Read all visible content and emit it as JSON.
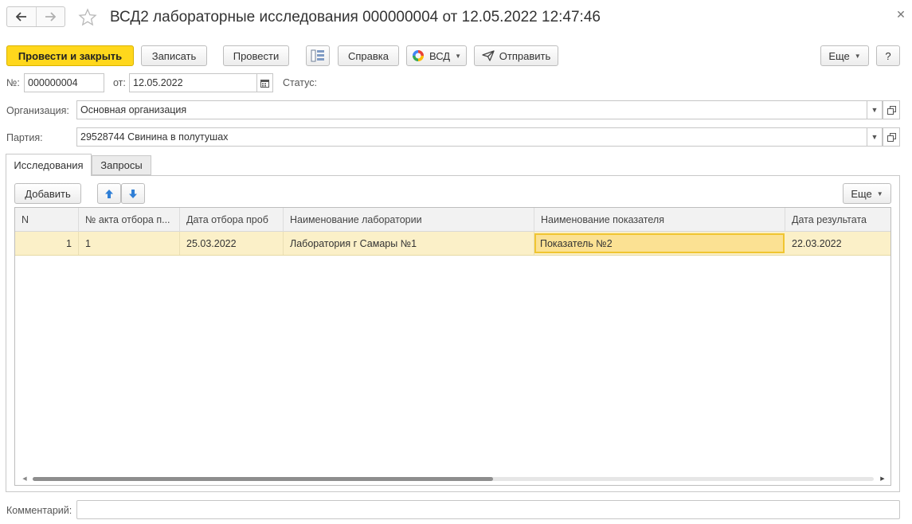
{
  "window": {
    "title": "ВСД2 лабораторные исследования 000000004 от 12.05.2022 12:47:46",
    "back_icon": "arrow-left",
    "forward_icon": "arrow-right",
    "favorite_icon": "star-outline",
    "close_icon": "close-x"
  },
  "toolbar": {
    "post_and_close": "Провести и закрыть",
    "save": "Записать",
    "post": "Провести",
    "structure_icon": "document-structure",
    "help": "Справка",
    "vsd": "ВСД",
    "send": "Отправить",
    "more": "Еще",
    "question": "?"
  },
  "header": {
    "number_label": "№:",
    "number_value": "000000004",
    "date_label": "от:",
    "date_value": "12.05.2022",
    "status_label": "Статус:",
    "organization_label": "Организация:",
    "organization_value": "Основная организация",
    "batch_label": "Партия:",
    "batch_value": "29528744 Свинина в полутушах"
  },
  "tabs": [
    {
      "label": "Исследования",
      "active": true
    },
    {
      "label": "Запросы",
      "active": false
    }
  ],
  "table_toolbar": {
    "add": "Добавить",
    "move_up_icon": "arrow-up",
    "move_down_icon": "arrow-down",
    "more": "Еще"
  },
  "table": {
    "columns": [
      "N",
      "№ акта отбора п...",
      "Дата отбора проб",
      "Наименование лаборатории",
      "Наименование показателя",
      "Дата результата"
    ],
    "rows": [
      [
        "1",
        "1",
        "25.03.2022",
        "Лаборатория г Самары №1",
        "Показатель №2",
        "22.03.2022"
      ]
    ]
  },
  "footer": {
    "comment_label": "Комментарий:",
    "comment_value": ""
  },
  "colors": {
    "primary_button": "#ffd71c",
    "selected_row": "#fbf0c8",
    "selected_cell": "#fbe193",
    "selected_cell_border": "#f0c531",
    "arrow_blue": "#2f7fd6"
  }
}
